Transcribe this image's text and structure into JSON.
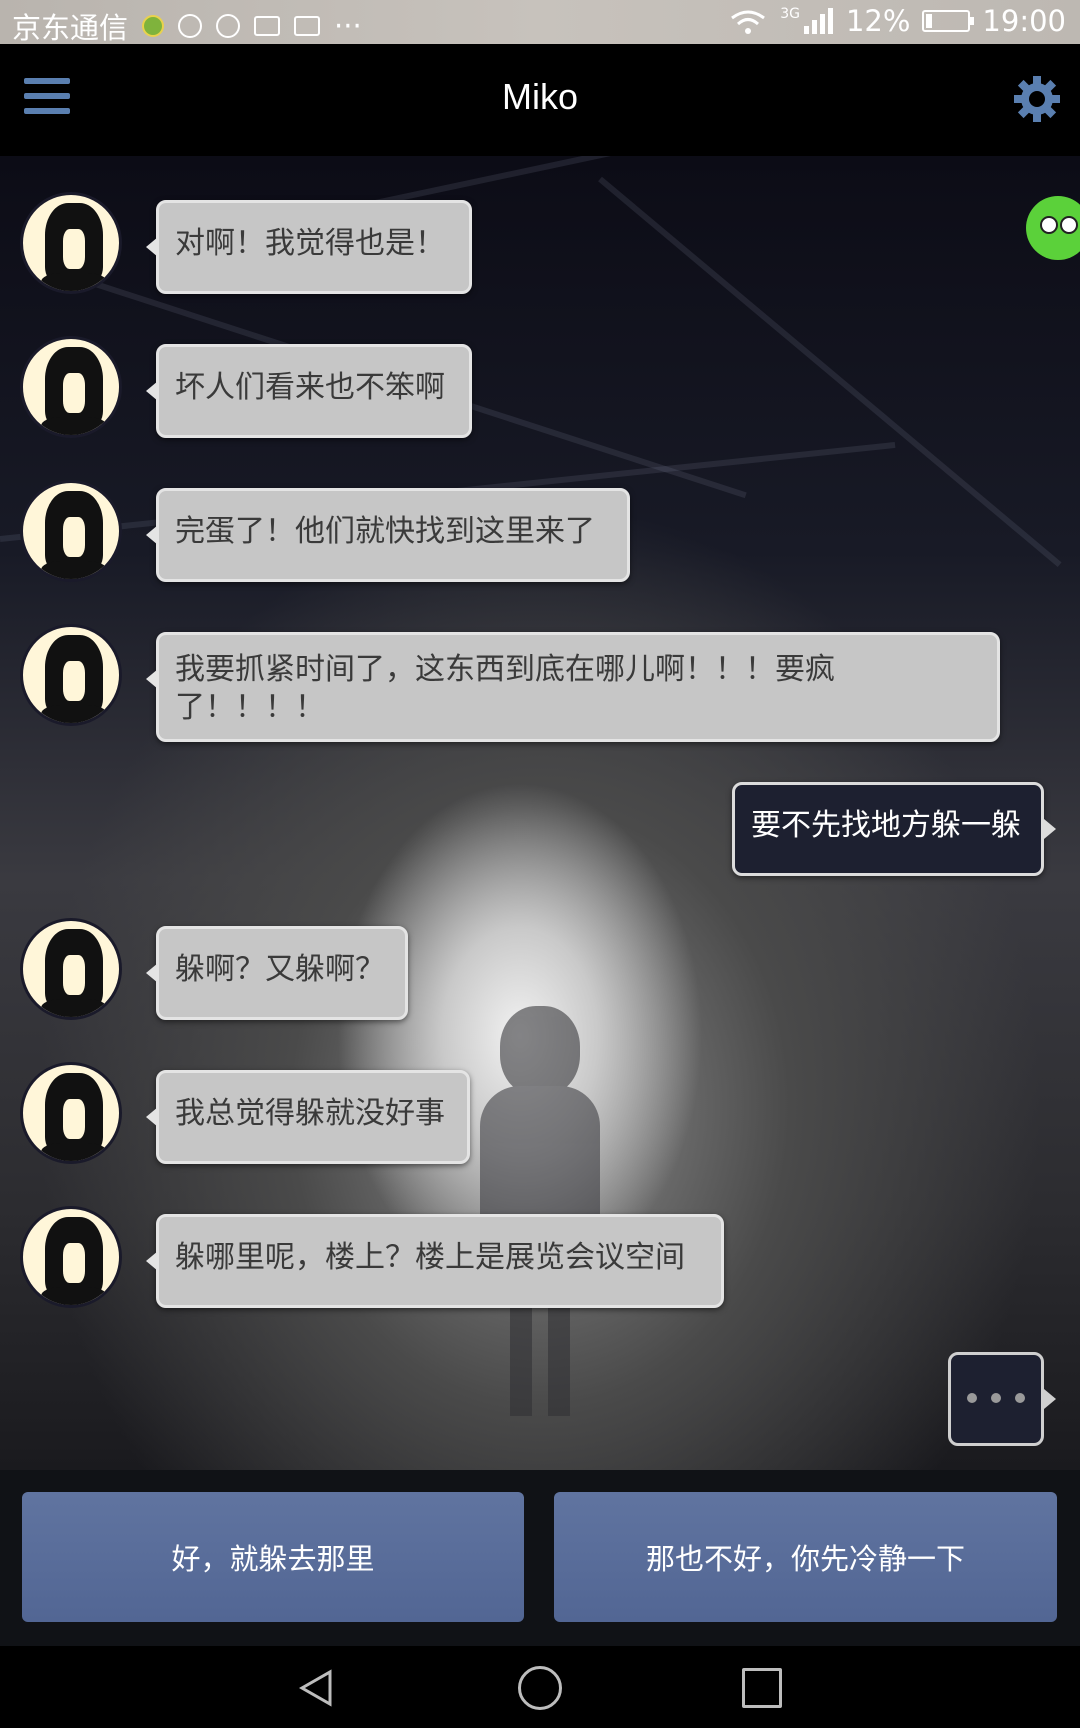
{
  "status_bar": {
    "carrier": "京东通信",
    "network": "3G",
    "battery_percent": "12%",
    "time": "19:00",
    "icons": [
      "app-badge-icon",
      "alarm-icon",
      "clock-icon",
      "mail-icon",
      "iqiyi-icon",
      "more-icon",
      "wifi-icon",
      "signal-icon",
      "battery-icon"
    ],
    "battery_level": 0.12
  },
  "header": {
    "title": "Miko",
    "menu_icon": "hamburger-menu-icon",
    "settings_icon": "gear-icon",
    "accent_color": "#5a7fb0"
  },
  "messages": [
    {
      "from": "miko",
      "text": "对啊！我觉得也是！"
    },
    {
      "from": "miko",
      "text": "坏人们看来也不笨啊"
    },
    {
      "from": "miko",
      "text": "完蛋了！他们就快找到这里来了"
    },
    {
      "from": "miko",
      "text": "我要抓紧时间了，这东西到底在哪儿啊！！！要疯了！！！！"
    },
    {
      "from": "me",
      "text": "要不先找地方躲一躲"
    },
    {
      "from": "miko",
      "text": "躲啊？又躲啊？"
    },
    {
      "from": "miko",
      "text": "我总觉得躲就没好事"
    },
    {
      "from": "miko",
      "text": "躲哪里呢，楼上？楼上是展览会议空间"
    }
  ],
  "typing_indicator": "...",
  "replies": [
    {
      "label": "好，就躲去那里"
    },
    {
      "label": "那也不好，你先冷静一下"
    }
  ],
  "nav": {
    "back_icon": "back-triangle-icon",
    "home_icon": "home-circle-icon",
    "recent_icon": "recent-apps-square-icon"
  }
}
